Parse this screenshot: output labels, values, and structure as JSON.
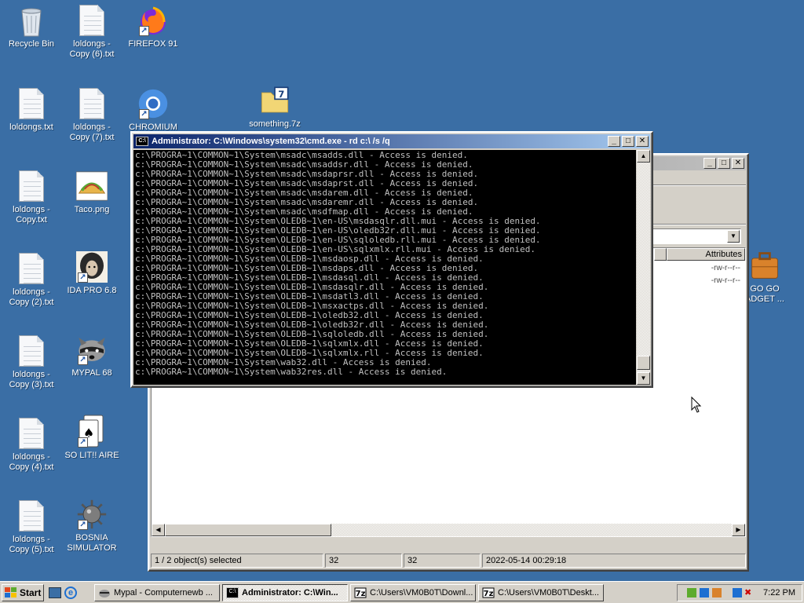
{
  "desktop": {
    "icons": [
      {
        "label": "Recycle Bin"
      },
      {
        "label": "loldongs - Copy (6).txt"
      },
      {
        "label": "FIREFOX 91"
      },
      {
        "label": "loldongs.txt"
      },
      {
        "label": "loldongs - Copy (7).txt"
      },
      {
        "label": "CHROMIUM"
      },
      {
        "label": "something.7z"
      },
      {
        "label": "loldongs - Copy.txt"
      },
      {
        "label": "Taco.png"
      },
      {
        "label": "loldongs - Copy (2).txt"
      },
      {
        "label": "IDA PRO 6.8"
      },
      {
        "label": "loldongs - Copy (3).txt"
      },
      {
        "label": "MYPAL 68"
      },
      {
        "label": "loldongs - Copy (4).txt"
      },
      {
        "label": "SO LIT!! AIRE"
      },
      {
        "label": "loldongs - Copy (5).txt"
      },
      {
        "label": "BOSNIA SIMULATOR"
      },
      {
        "label": "GO GO ADGET ..."
      }
    ]
  },
  "cmd_window": {
    "title": "Administrator: C:\\Windows\\system32\\cmd.exe - rd  c:\\ /s /q",
    "lines": [
      "c:\\PROGRA~1\\COMMON~1\\System\\msadc\\msadds.dll - Access is denied.",
      "c:\\PROGRA~1\\COMMON~1\\System\\msadc\\msaddsr.dll - Access is denied.",
      "c:\\PROGRA~1\\COMMON~1\\System\\msadc\\msdaprsr.dll - Access is denied.",
      "c:\\PROGRA~1\\COMMON~1\\System\\msadc\\msdaprst.dll - Access is denied.",
      "c:\\PROGRA~1\\COMMON~1\\System\\msadc\\msdarem.dll - Access is denied.",
      "c:\\PROGRA~1\\COMMON~1\\System\\msadc\\msdaremr.dll - Access is denied.",
      "c:\\PROGRA~1\\COMMON~1\\System\\msadc\\msdfmap.dll - Access is denied.",
      "c:\\PROGRA~1\\COMMON~1\\System\\OLEDB~1\\en-US\\msdasqlr.dll.mui - Access is denied.",
      "c:\\PROGRA~1\\COMMON~1\\System\\OLEDB~1\\en-US\\oledb32r.dll.mui - Access is denied.",
      "c:\\PROGRA~1\\COMMON~1\\System\\OLEDB~1\\en-US\\sqloledb.rll.mui - Access is denied.",
      "c:\\PROGRA~1\\COMMON~1\\System\\OLEDB~1\\en-US\\sqlxmlx.rll.mui - Access is denied.",
      "c:\\PROGRA~1\\COMMON~1\\System\\OLEDB~1\\msdaosp.dll - Access is denied.",
      "c:\\PROGRA~1\\COMMON~1\\System\\OLEDB~1\\msdaps.dll - Access is denied.",
      "c:\\PROGRA~1\\COMMON~1\\System\\OLEDB~1\\msdasql.dll - Access is denied.",
      "c:\\PROGRA~1\\COMMON~1\\System\\OLEDB~1\\msdasqlr.dll - Access is denied.",
      "c:\\PROGRA~1\\COMMON~1\\System\\OLEDB~1\\msdatl3.dll - Access is denied.",
      "c:\\PROGRA~1\\COMMON~1\\System\\OLEDB~1\\msxactps.dll - Access is denied.",
      "c:\\PROGRA~1\\COMMON~1\\System\\OLEDB~1\\oledb32.dll - Access is denied.",
      "c:\\PROGRA~1\\COMMON~1\\System\\OLEDB~1\\oledb32r.dll - Access is denied.",
      "c:\\PROGRA~1\\COMMON~1\\System\\OLEDB~1\\sqloledb.dll - Access is denied.",
      "c:\\PROGRA~1\\COMMON~1\\System\\OLEDB~1\\sqlxmlx.dll - Access is denied.",
      "c:\\PROGRA~1\\COMMON~1\\System\\OLEDB~1\\sqlxmlx.rll - Access is denied.",
      "c:\\PROGRA~1\\COMMON~1\\System\\wab32.dll - Access is denied.",
      "c:\\PROGRA~1\\COMMON~1\\System\\wab32res.dll - Access is denied."
    ]
  },
  "explorer_window": {
    "column_header": "Attributes",
    "rows": [
      {
        "attributes": "-rw-r--r--"
      },
      {
        "attributes": "-rw-r--r--"
      }
    ],
    "status": {
      "selection": "1 / 2 object(s) selected",
      "size1": "32",
      "size2": "32",
      "date": "2022-05-14 00:29:18"
    }
  },
  "taskbar": {
    "start_label": "Start",
    "tasks": [
      {
        "label": "Mypal - Computernewb ..."
      },
      {
        "label": "Administrator: C:\\Win..."
      },
      {
        "label": "C:\\Users\\VM0B0T\\Downl..."
      },
      {
        "label": "C:\\Users\\VM0B0T\\Deskt..."
      }
    ],
    "clock": "7:22 PM"
  },
  "colors": {
    "desktop": "#3a6ea5",
    "title_active": "#0a246a",
    "console_bg": "#000000",
    "console_fg": "#c0c0c0"
  }
}
